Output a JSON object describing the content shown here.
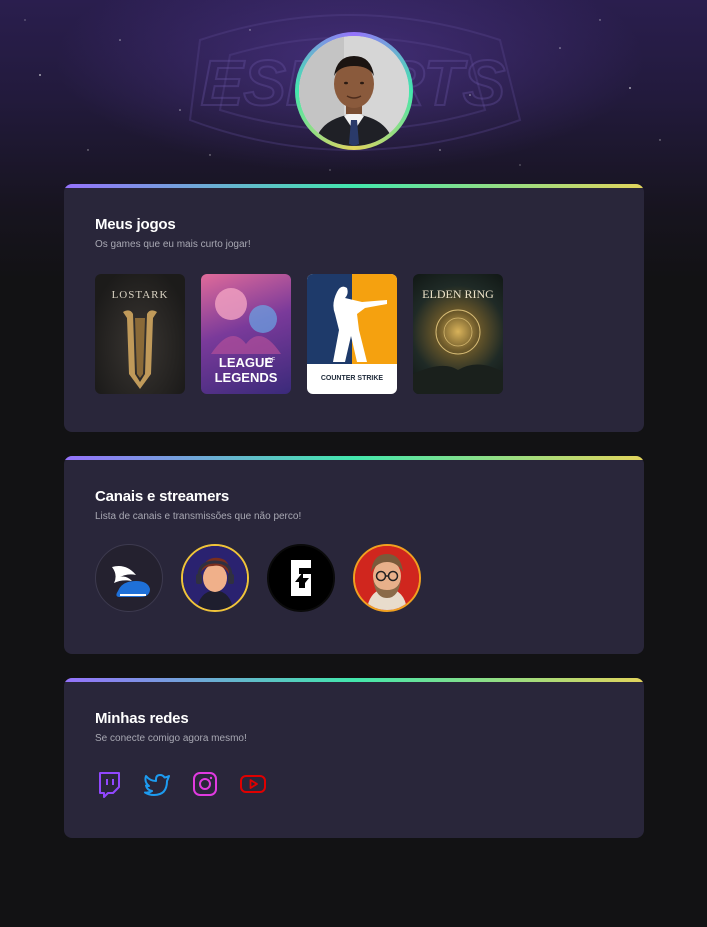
{
  "sections": {
    "games": {
      "title": "Meus jogos",
      "subtitle": "Os games que eu mais curto jogar!",
      "items": [
        {
          "name": "Lost Ark",
          "logo_text": "LOSTARK"
        },
        {
          "name": "League of Legends",
          "logo_line1": "LEAGUE",
          "logo_line2": "LEGENDS",
          "logo_of": "OF"
        },
        {
          "name": "Counter-Strike",
          "logo_text": "COUNTER STRIKE"
        },
        {
          "name": "Elden Ring",
          "logo_text": "ELDEN RING"
        }
      ]
    },
    "streamers": {
      "title": "Canais e streamers",
      "subtitle": "Lista de canais e transmissões que não perco!",
      "items": [
        {
          "name": "streamer-1",
          "icon": "winged-shoe-icon"
        },
        {
          "name": "streamer-2",
          "icon": "gamer-avatar-icon"
        },
        {
          "name": "streamer-3",
          "icon": "rainbow-six-icon"
        },
        {
          "name": "streamer-4",
          "icon": "bearded-avatar-icon"
        }
      ]
    },
    "socials": {
      "title": "Minhas redes",
      "subtitle": "Se conecte comigo agora mesmo!",
      "items": [
        {
          "name": "twitch",
          "icon": "twitch-icon",
          "color": "#9147ff"
        },
        {
          "name": "twitter",
          "icon": "twitter-icon",
          "color": "#1d9bf0"
        },
        {
          "name": "instagram",
          "icon": "instagram-icon",
          "color": "#e03ae0"
        },
        {
          "name": "youtube",
          "icon": "youtube-icon",
          "color": "#e00000"
        }
      ]
    }
  },
  "hero": {
    "watermark": "ESPORTS"
  },
  "colors": {
    "gradient_start": "#9572fc",
    "gradient_mid": "#43e7ad",
    "gradient_end": "#e2d45c",
    "card_bg": "#29263a",
    "page_bg": "#121214"
  }
}
